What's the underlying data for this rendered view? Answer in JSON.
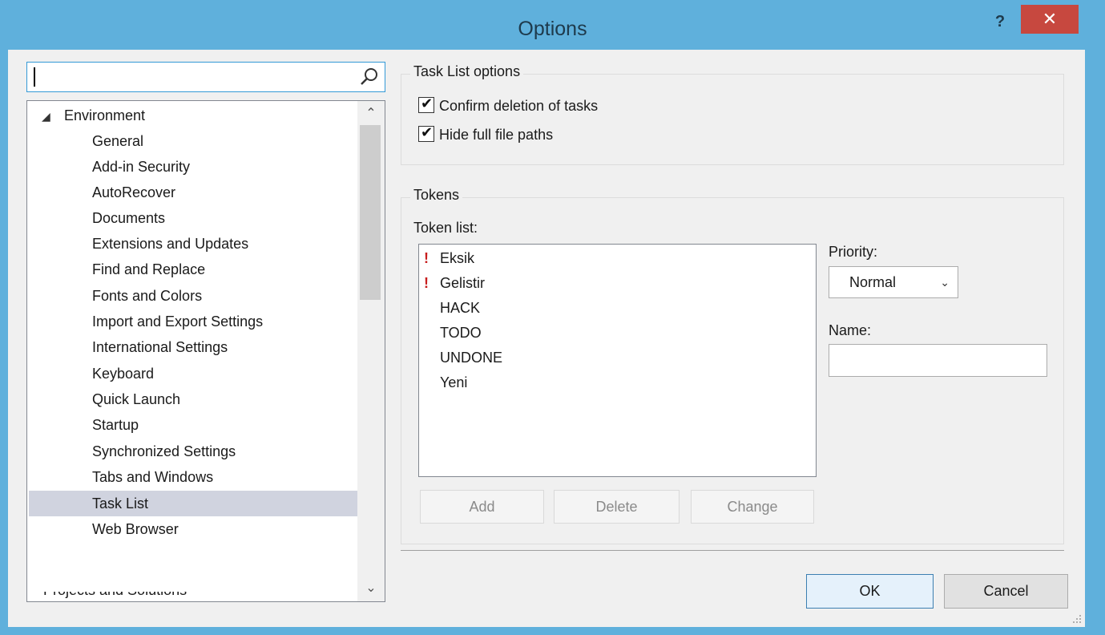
{
  "window": {
    "title": "Options",
    "help_label": "?",
    "close_label": "✕"
  },
  "search": {
    "value": "",
    "placeholder": "",
    "icon": "search-icon"
  },
  "tree": {
    "root_label": "Environment",
    "root_arrow": "◢",
    "items": [
      "General",
      "Add-in Security",
      "AutoRecover",
      "Documents",
      "Extensions and Updates",
      "Find and Replace",
      "Fonts and Colors",
      "Import and Export Settings",
      "International Settings",
      "Keyboard",
      "Quick Launch",
      "Startup",
      "Synchronized Settings",
      "Tabs and Windows",
      "Task List",
      "Web Browser"
    ],
    "selected": "Task List",
    "partial_next_label": "Projects and Solutions",
    "scroll_up": "⌃",
    "scroll_down": "⌄"
  },
  "task_list_options": {
    "title": "Task List options",
    "confirm_deletion": {
      "label": "Confirm deletion of tasks",
      "checked": true
    },
    "hide_paths": {
      "label": "Hide full file paths",
      "checked": true
    },
    "check_glyph": "✔"
  },
  "tokens": {
    "title": "Tokens",
    "list_label": "Token list:",
    "items": [
      {
        "name": "Eksik",
        "marker": "!"
      },
      {
        "name": "Gelistir",
        "marker": "!"
      },
      {
        "name": "HACK",
        "marker": ""
      },
      {
        "name": "TODO",
        "marker": ""
      },
      {
        "name": "UNDONE",
        "marker": ""
      },
      {
        "name": "Yeni",
        "marker": ""
      }
    ],
    "priority_label": "Priority:",
    "priority_value": "Normal",
    "priority_chevron": "⌄",
    "name_label": "Name:",
    "name_value": "",
    "add_label": "Add",
    "delete_label": "Delete",
    "change_label": "Change"
  },
  "footer": {
    "ok_label": "OK",
    "cancel_label": "Cancel"
  },
  "colors": {
    "titlebar": "#5fb0dc",
    "close": "#c7483f",
    "priority_marker": "#c81e1e",
    "selection": "#d0d3df"
  }
}
